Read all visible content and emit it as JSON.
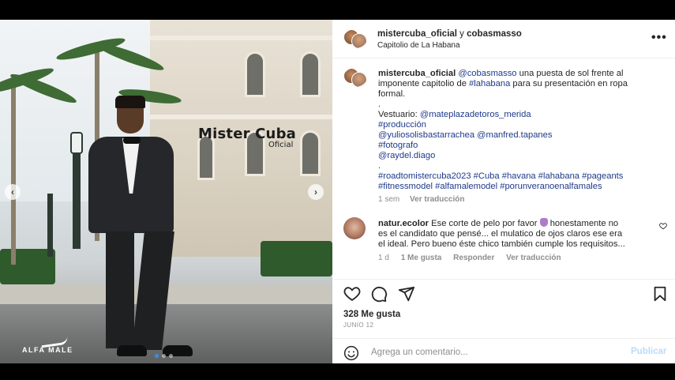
{
  "post": {
    "photo": {
      "overlay_title": "Mister Cuba",
      "overlay_subtitle": "Oficial",
      "brand": "ALFA MALE",
      "slides": 3,
      "current_slide": 1
    },
    "header": {
      "user_main": "mistercuba_oficial",
      "user_join": " y ",
      "user_collab": "cobasmasso",
      "location": "Capitolio de La Habana",
      "more_icon": "more-horizontal-icon"
    },
    "caption": {
      "username": "mistercuba_oficial",
      "mention": "@cobasmasso",
      "text_1": " una puesta de sol frente al",
      "text_2a": "imponente capitolio de ",
      "hashtag_habana": "#lahabana",
      "text_2b": " para su presentación en ropa",
      "text_3": "formal.",
      "dot_1": ".",
      "vestuario_label": "Vestuario: ",
      "vestuario_mention": "@mateplazadetoros_merida",
      "produccion": "#producción",
      "prod_mention_1": "@yuliosolisbastarrachea",
      "prod_mention_2": "@manfred.tapanes",
      "fotografo": "#fotografo",
      "photo_mention": "@raydel.diago",
      "dot_2": ".",
      "tags_1": "#roadtomistercuba2023 #Cuba #havana #lahabana #pageants",
      "tags_2": "#fitnessmodel #alfamalemodel #porunveranoenalfamales",
      "time": "1 sem",
      "translate": "Ver traducción"
    },
    "comment": {
      "username": "natur.ecolor",
      "line_1a": " Ese corte de pelo por favor ",
      "line_1b": "  honestamente no",
      "line_2": "es el candidato que pensé... el mulatico de ojos claros ese era",
      "line_3": "el ideal. Pero bueno éste chico también cumple los requisitos...",
      "time": "1 d",
      "likes": "1 Me gusta",
      "reply": "Responder",
      "translate": "Ver traducción"
    },
    "actions": {
      "like_icon": "heart-icon",
      "comment_icon": "comment-icon",
      "share_icon": "send-icon",
      "save_icon": "bookmark-icon"
    },
    "likes": "328 Me gusta",
    "date": "JUNIO 12",
    "add_comment": {
      "placeholder": "Agrega un comentario...",
      "publish": "Publicar"
    }
  }
}
